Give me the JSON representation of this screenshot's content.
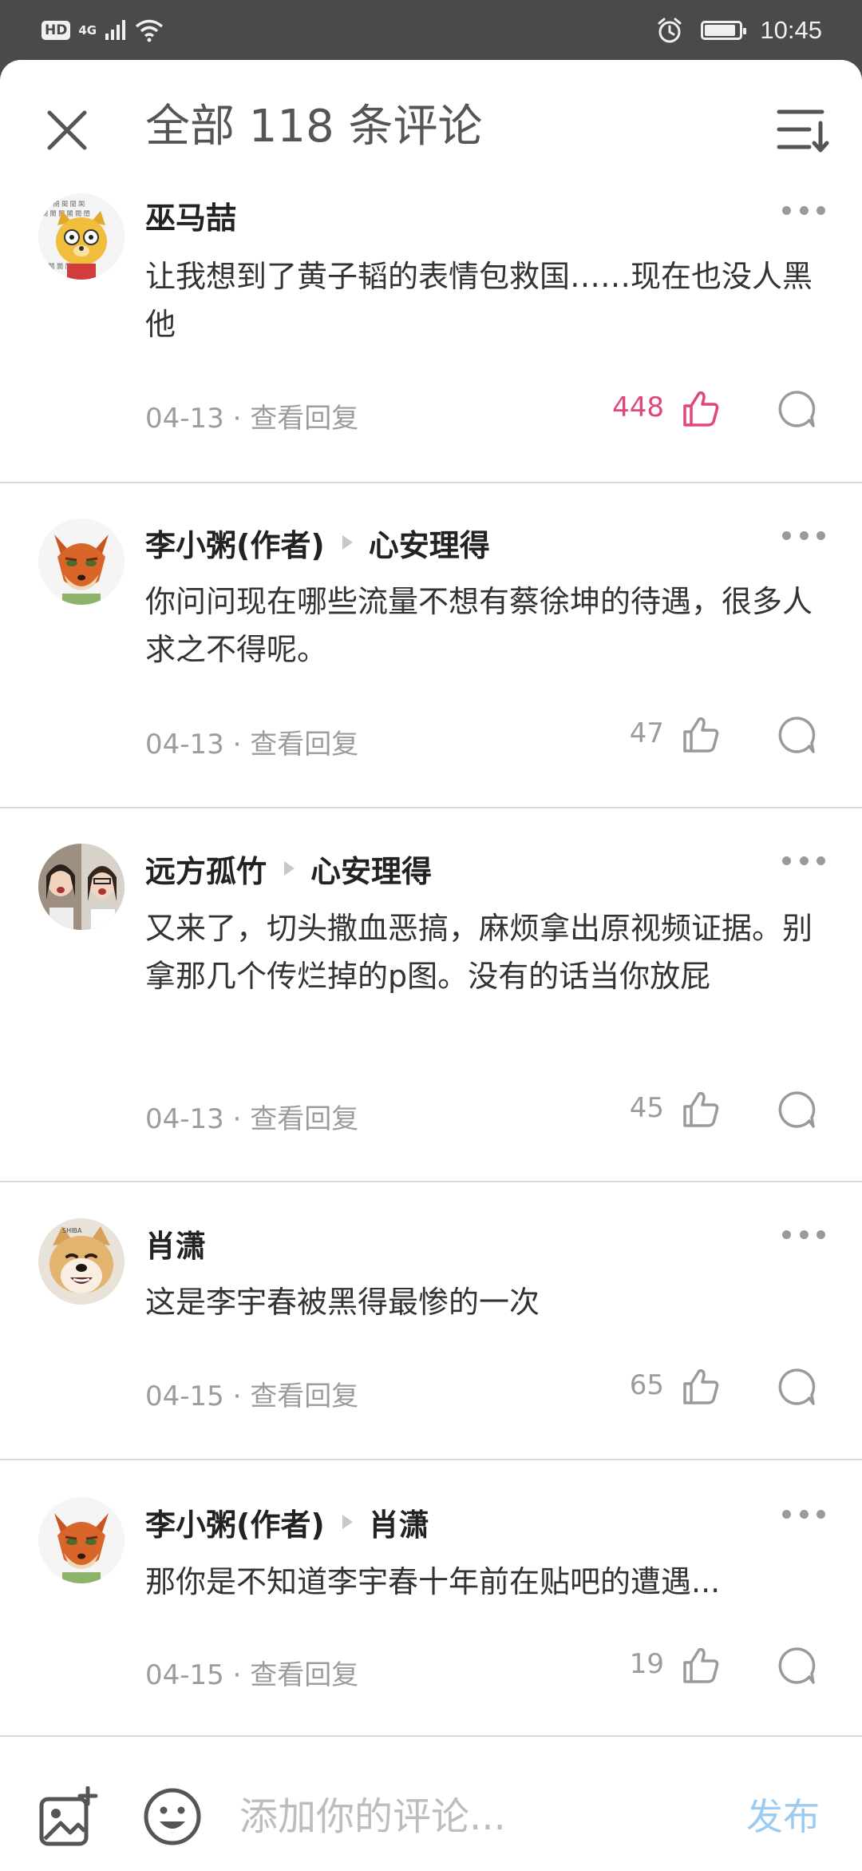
{
  "status_bar": {
    "hd": "HD",
    "network": "4G",
    "time": "10:45",
    "battery_level": 0.9,
    "icons": [
      "signal-icon",
      "wifi-icon",
      "alarm-icon",
      "battery-icon"
    ]
  },
  "header": {
    "title": "全部 118 条评论",
    "close_icon": "close-icon",
    "sort_icon": "sort-icon"
  },
  "comments": [
    {
      "user": "巫马喆",
      "reply_to": "",
      "text": "让我想到了黄子韬的表情包救国……现在也没人黑他",
      "date": "04-13",
      "view_replies": "查看回复",
      "likes": "448",
      "liked": true,
      "avatar": "cartoon-dog-avatar"
    },
    {
      "user": "李小粥(作者)",
      "reply_to": "心安理得",
      "text": "你问问现在哪些流量不想有蔡徐坤的待遇，很多人求之不得呢。",
      "date": "04-13",
      "view_replies": "查看回复",
      "likes": "47",
      "liked": false,
      "avatar": "fox-avatar"
    },
    {
      "user": "远方孤竹",
      "reply_to": "心安理得",
      "text": "又来了，切头撒血恶搞，麻烦拿出原视频证据。别拿那几个传烂掉的p图。没有的话当你放屁",
      "date": "04-13",
      "view_replies": "查看回复",
      "likes": "45",
      "liked": false,
      "avatar": "photo-avatar"
    },
    {
      "user": "肖潇",
      "reply_to": "",
      "text": "这是李宇春被黑得最惨的一次",
      "date": "04-15",
      "view_replies": "查看回复",
      "likes": "65",
      "liked": false,
      "avatar": "shiba-avatar"
    },
    {
      "user": "李小粥(作者)",
      "reply_to": "肖潇",
      "text": "那你是不知道李宇春十年前在贴吧的遭遇...",
      "date": "04-15",
      "view_replies": "查看回复",
      "likes": "19",
      "liked": false,
      "avatar": "fox-avatar"
    }
  ],
  "composer": {
    "placeholder": "添加你的评论...",
    "publish_label": "发布",
    "image_icon": "add-image-icon",
    "emoji_icon": "emoji-icon"
  },
  "colors": {
    "accent_like": "#e0457b",
    "publish": "#9ccbef",
    "muted": "#9c9c9c"
  }
}
